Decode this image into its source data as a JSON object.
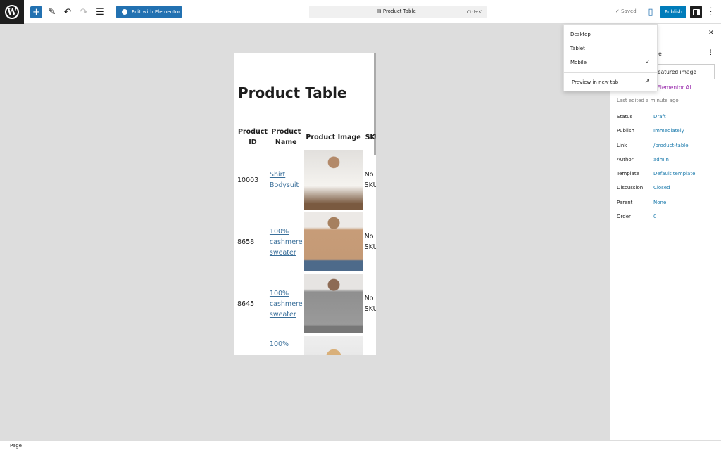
{
  "toolbar": {
    "logo": "W",
    "add_icon": "+",
    "elementor_label": "Edit with Elementor",
    "command_title": "Product Table",
    "command_shortcut": "Ctrl+K",
    "saved_label": "✓ Saved",
    "publish_label": "Publish"
  },
  "canvas": {
    "title": "Product Table",
    "headers": [
      "Product ID",
      "Product Name",
      "Product Image",
      "SKU"
    ],
    "rows": [
      {
        "id": "10003",
        "name": "Shirt Bodysuit",
        "sku": "No SKU"
      },
      {
        "id": "8658",
        "name": "100% cashmere sweater",
        "sku": "No SKU"
      },
      {
        "id": "8645",
        "name": "100% cashmere sweater",
        "sku": "No SKU"
      },
      {
        "id": "",
        "name": "100%",
        "sku": ""
      }
    ]
  },
  "preview_menu": {
    "items": [
      "Desktop",
      "Tablet",
      "Mobile"
    ],
    "selected": "Mobile",
    "check": "✓",
    "new_tab": "Preview in new tab"
  },
  "panel": {
    "title_fragment": "le",
    "featured_fragment": "eatured image",
    "ai_fragment": "Elementor AI",
    "last_edited": "Last edited a minute ago.",
    "rows": [
      {
        "label": "Status",
        "value": "Draft"
      },
      {
        "label": "Publish",
        "value": "Immediately"
      },
      {
        "label": "Link",
        "value": "/product-table"
      },
      {
        "label": "Author",
        "value": "admin"
      },
      {
        "label": "Template",
        "value": "Default template"
      },
      {
        "label": "Discussion",
        "value": "Closed"
      },
      {
        "label": "Parent",
        "value": "None"
      },
      {
        "label": "Order",
        "value": "0"
      }
    ]
  },
  "statusbar": {
    "breadcrumb": "Page"
  }
}
